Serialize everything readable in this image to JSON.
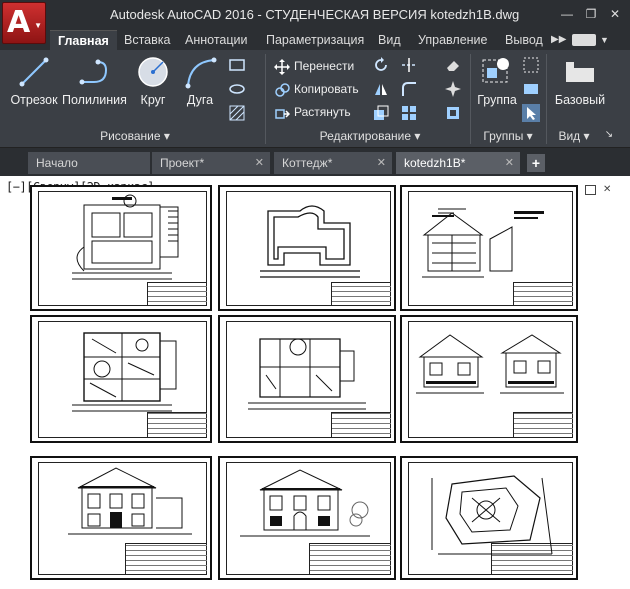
{
  "titlebar": {
    "title": "Autodesk AutoCAD 2016 - СТУДЕНЧЕСКАЯ ВЕРСИЯ    kotedzh1B.dwg",
    "app_logo": "A",
    "controls": {
      "minimize": "—",
      "restore": "❐",
      "close": "✕"
    }
  },
  "ribbon_tabs": [
    {
      "label": "Главная",
      "active": true
    },
    {
      "label": "Вставка"
    },
    {
      "label": "Аннотации"
    },
    {
      "label": "Параметризация"
    },
    {
      "label": "Вид"
    },
    {
      "label": "Управление"
    },
    {
      "label": "Вывод"
    }
  ],
  "ribbon_tabs_more": "▶▶",
  "panels": {
    "draw": {
      "title": "Рисование ▾",
      "buttons": [
        {
          "label": "Отрезок",
          "icon": "line-icon"
        },
        {
          "label": "Полилиния",
          "icon": "polyline-icon"
        },
        {
          "label": "Круг",
          "icon": "circle-icon"
        },
        {
          "label": "Дуга",
          "icon": "arc-icon"
        }
      ]
    },
    "modify": {
      "title": "Редактирование ▾",
      "rows": [
        {
          "label": "Перенести",
          "icon": "move-icon"
        },
        {
          "label": "Копировать",
          "icon": "copy-icon"
        },
        {
          "label": "Растянуть",
          "icon": "stretch-icon"
        }
      ]
    },
    "groups": {
      "title": "Группы ▾",
      "button": "Группа"
    },
    "view": {
      "title": "Вид ▾",
      "button": "Базовый"
    }
  },
  "doc_tabs": [
    {
      "label": "Начало"
    },
    {
      "label": "Проект*",
      "close": "✕"
    },
    {
      "label": "Коттедж*",
      "close": "✕"
    },
    {
      "label": "kotedzh1B*",
      "close": "✕",
      "active": true
    }
  ],
  "new_tab": "+",
  "viewport_label": "[−][Сверху][2D-каркас]",
  "colors": {
    "accent": "#cf3030",
    "ribbon": "#3b3f45",
    "titlebar": "#2c2f33"
  }
}
